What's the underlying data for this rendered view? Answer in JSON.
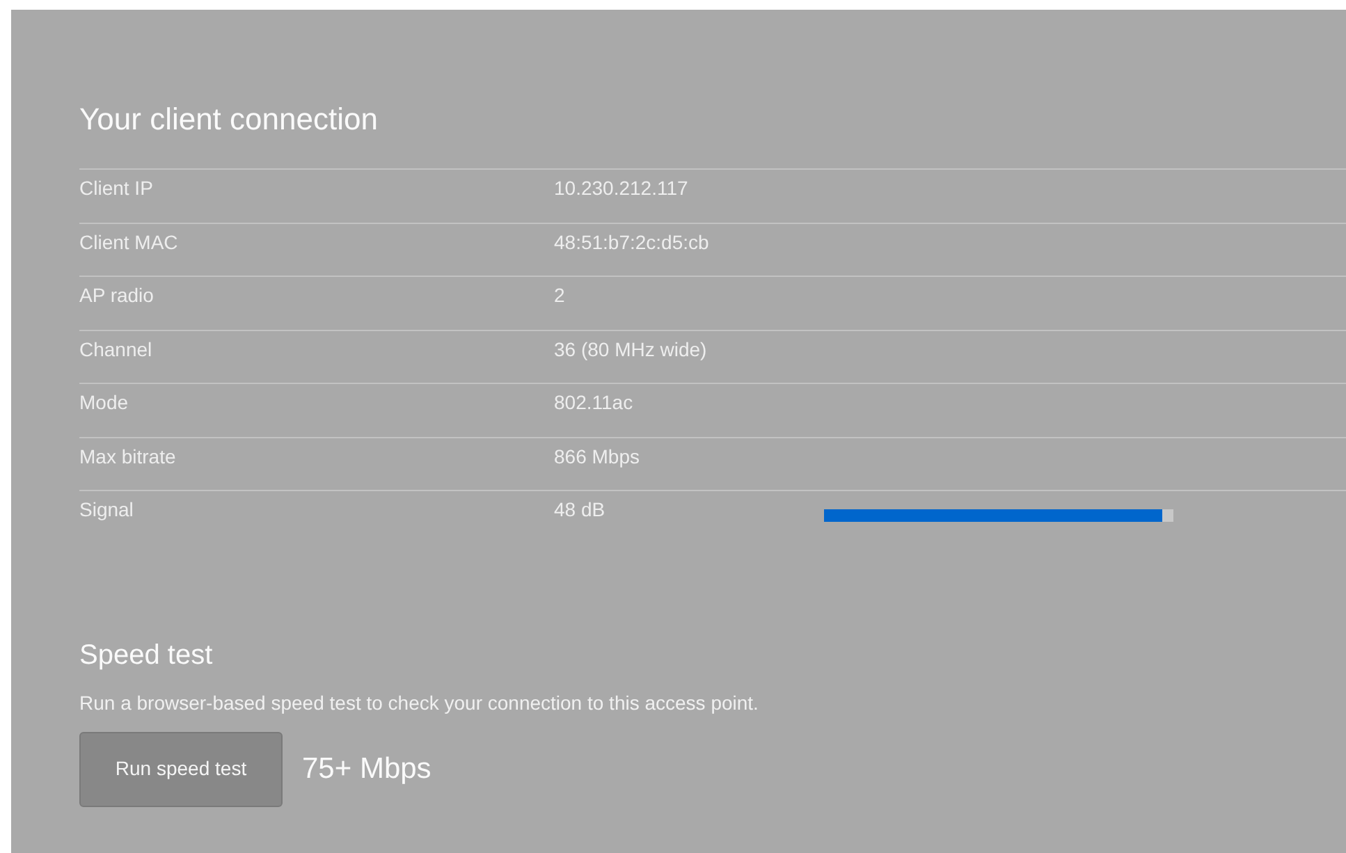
{
  "connection": {
    "title": "Your client connection",
    "rows": [
      {
        "label": "Client IP",
        "value": "10.230.212.117"
      },
      {
        "label": "Client MAC",
        "value": "48:51:b7:2c:d5:cb"
      },
      {
        "label": "AP radio",
        "value": "2"
      },
      {
        "label": "Channel",
        "value": "36 (80 MHz wide)"
      },
      {
        "label": "Mode",
        "value": "802.11ac"
      },
      {
        "label": "Max bitrate",
        "value": "866 Mbps"
      },
      {
        "label": "Signal",
        "value": "48 dB",
        "level": 0.97
      }
    ]
  },
  "speed_test": {
    "title": "Speed test",
    "description": "Run a browser-based speed test to check your connection to this access point.",
    "button": "Run speed test",
    "result": "75+ Mbps"
  }
}
